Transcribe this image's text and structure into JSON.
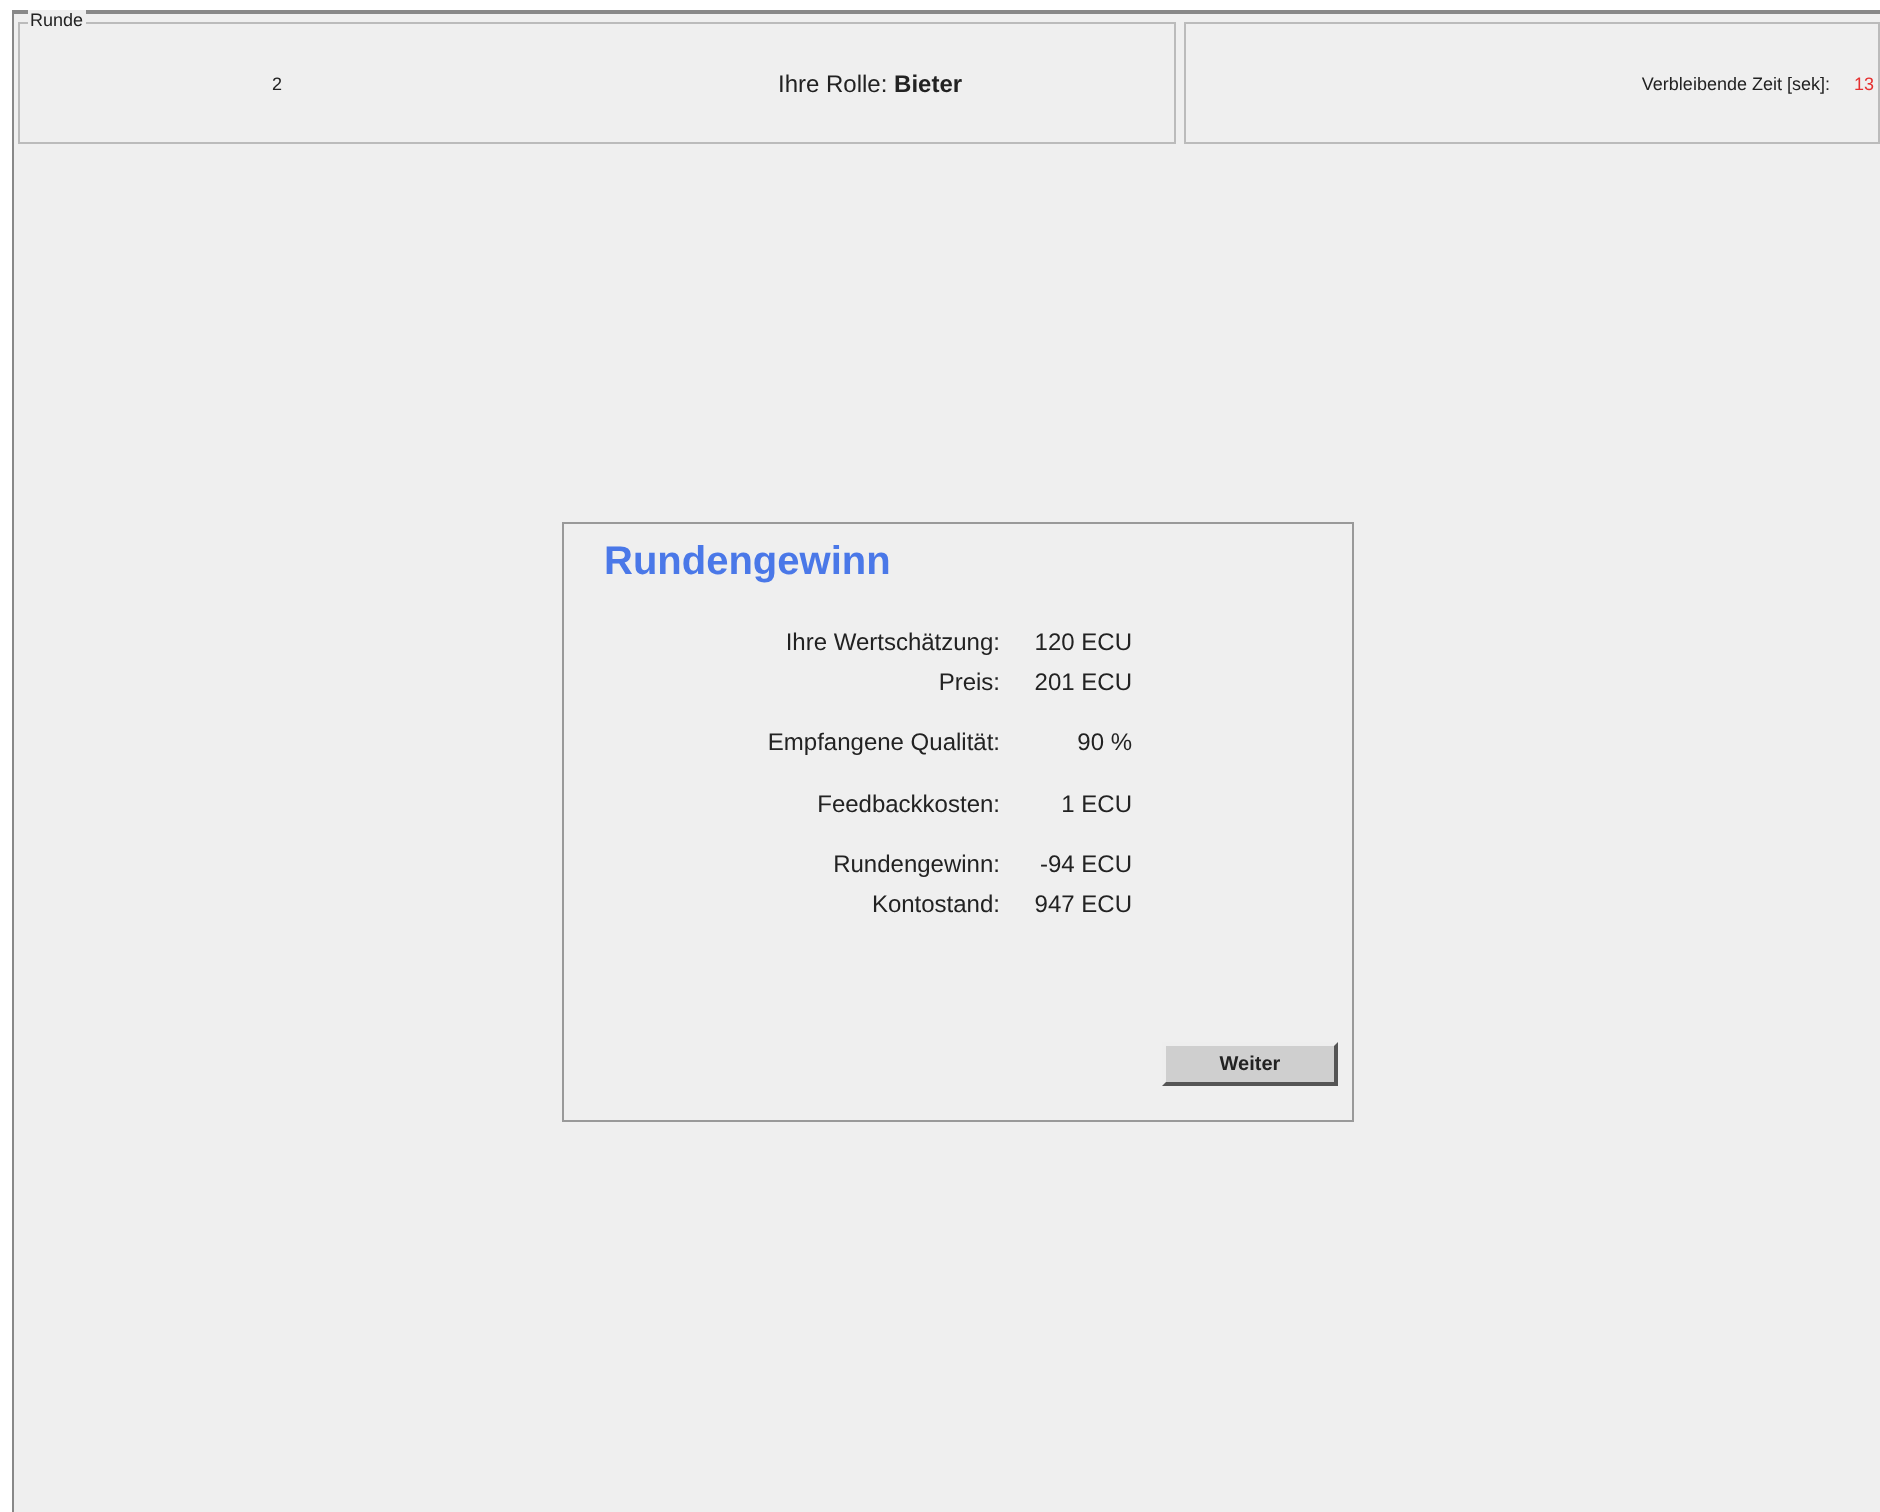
{
  "header": {
    "legend": "Runde",
    "round": "2",
    "role": "Ihre Rolle: **Bieter**"
  },
  "timer": {
    "label": "Verbleibende Zeit [sek]:",
    "value": "13"
  },
  "dialog": {
    "title": "Rundengewinn",
    "groups": [
      [
        {
          "label": "Ihre Wertschätzung:",
          "value": "120 ECU"
        },
        {
          "label": "Preis:",
          "value": "201 ECU"
        }
      ],
      [
        {
          "label": "Empfangene Qualität:",
          "value": "90 %"
        }
      ],
      [
        {
          "label": "Feedbackkosten:",
          "value": "1 ECU"
        }
      ],
      [
        {
          "label": "Rundengewinn:",
          "value": "-94 ECU"
        },
        {
          "label": "Kontostand:",
          "value": "947 ECU"
        }
      ]
    ],
    "button": "Weiter"
  }
}
